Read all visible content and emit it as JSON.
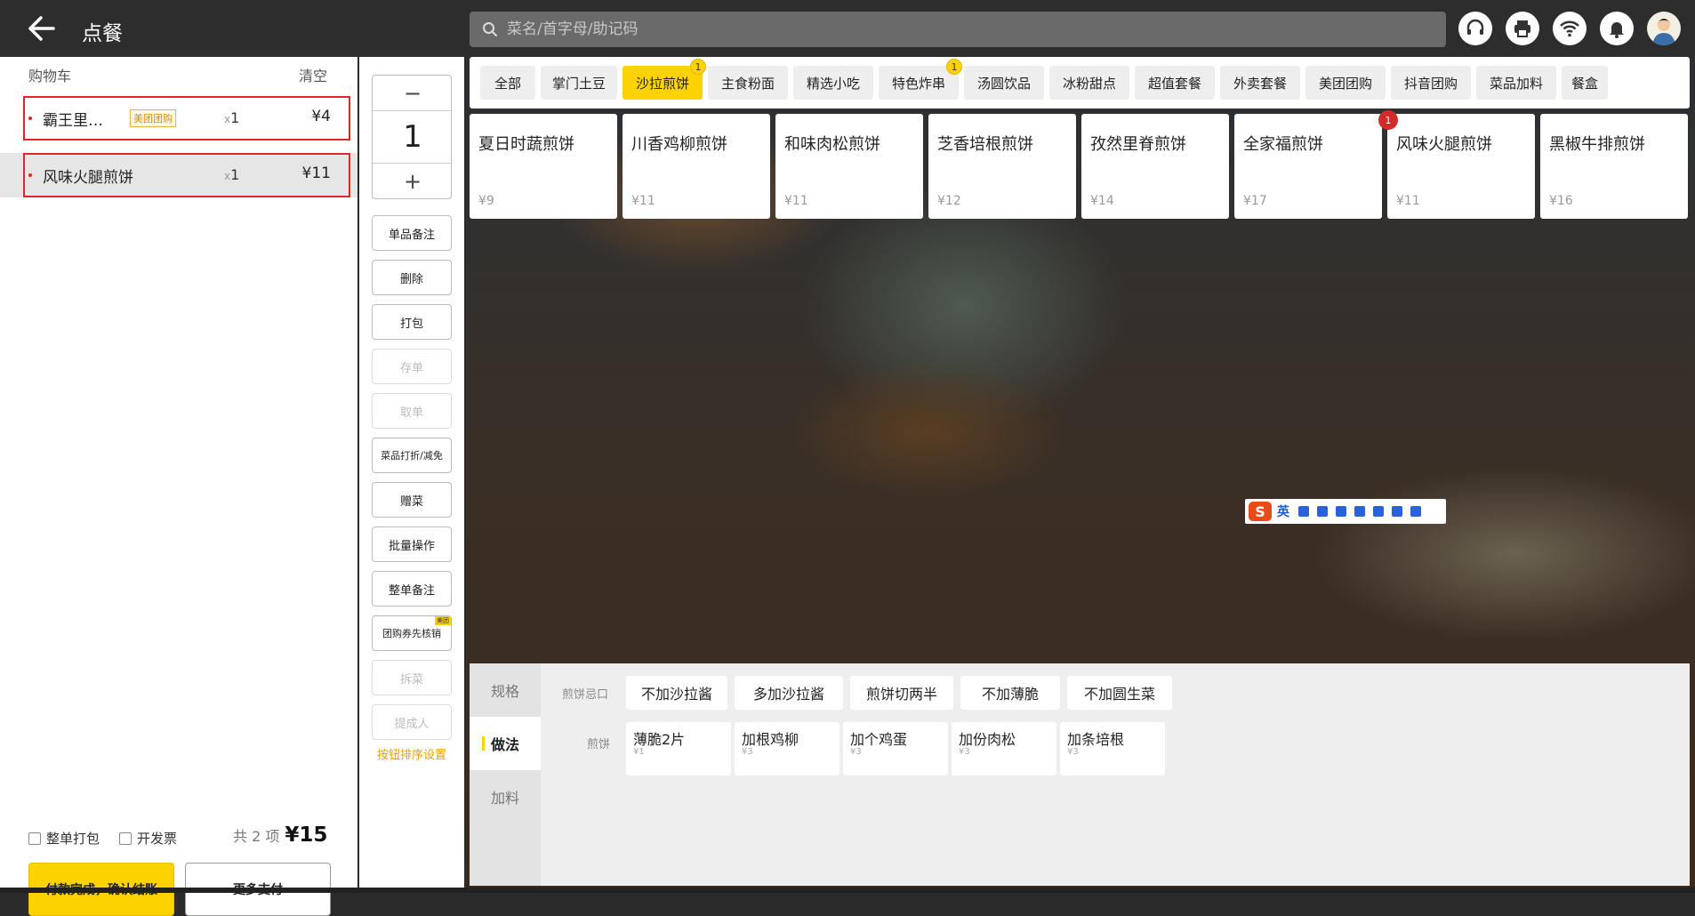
{
  "header": {
    "title": "点餐",
    "search_placeholder": "菜名/首字母/助记码",
    "icons": [
      "headset-icon",
      "printer-icon",
      "wifi-icon",
      "bell-icon",
      "avatar"
    ]
  },
  "cart": {
    "title": "购物车",
    "clear_label": "清空",
    "items": [
      {
        "name": "霸王里…",
        "tag": "美团团购",
        "qty_prefix": "x",
        "qty": "1",
        "price": "¥4"
      },
      {
        "name": "风味火腿煎饼",
        "tag": "",
        "qty_prefix": "x",
        "qty": "1",
        "price": "¥11"
      }
    ],
    "whole_pack_label": "整单打包",
    "invoice_label": "开发票",
    "total_label": "共 2 项",
    "total_value": "¥15",
    "pay_label": "付款完成，确认结账",
    "more_pay_label": "更多支付"
  },
  "actions": {
    "minus": "−",
    "quantity": "1",
    "plus": "+",
    "buttons": [
      {
        "label": "单品备注",
        "enabled": true
      },
      {
        "label": "删除",
        "enabled": true
      },
      {
        "label": "打包",
        "enabled": true
      },
      {
        "label": "存单",
        "enabled": false
      },
      {
        "label": "取单",
        "enabled": false
      },
      {
        "label": "菜品打折/减免",
        "enabled": true
      },
      {
        "label": "赠菜",
        "enabled": true
      },
      {
        "label": "批量操作",
        "enabled": true
      },
      {
        "label": "整单备注",
        "enabled": true
      },
      {
        "label": "团购券先核销",
        "enabled": true,
        "corner": "美团"
      },
      {
        "label": "拆菜",
        "enabled": false
      },
      {
        "label": "提成人",
        "enabled": false
      }
    ],
    "sort_label": "按钮排序设置"
  },
  "categories": [
    {
      "label": "全部"
    },
    {
      "label": "掌门土豆"
    },
    {
      "label": "沙拉煎饼",
      "active": true,
      "badge": "1"
    },
    {
      "label": "主食粉面"
    },
    {
      "label": "精选小吃"
    },
    {
      "label": "特色炸串",
      "badge": "1"
    },
    {
      "label": "汤圆饮品"
    },
    {
      "label": "冰粉甜点"
    },
    {
      "label": "超值套餐"
    },
    {
      "label": "外卖套餐"
    },
    {
      "label": "美团团购"
    },
    {
      "label": "抖音团购"
    },
    {
      "label": "菜品加料"
    },
    {
      "label": "餐盒"
    }
  ],
  "dishes": [
    {
      "name": "夏日时蔬煎饼",
      "price": "¥9"
    },
    {
      "name": "川香鸡柳煎饼",
      "price": "¥11"
    },
    {
      "name": "和味肉松煎饼",
      "price": "¥11"
    },
    {
      "name": "芝香培根煎饼",
      "price": "¥12"
    },
    {
      "name": "孜然里脊煎饼",
      "price": "¥14"
    },
    {
      "name": "全家福煎饼",
      "price": "¥17"
    },
    {
      "name": "风味火腿煎饼",
      "price": "¥11",
      "badge": "1"
    },
    {
      "name": "黑椒牛排煎饼",
      "price": "¥16"
    }
  ],
  "ime": {
    "logo": "S",
    "mode": "英"
  },
  "spec": {
    "tabs": [
      {
        "label": "规格"
      },
      {
        "label": "做法",
        "active": true
      },
      {
        "label": "加料"
      }
    ],
    "groups": [
      {
        "label": "煎饼忌口",
        "options": [
          {
            "name": "不加沙拉酱"
          },
          {
            "name": "多加沙拉酱"
          },
          {
            "name": "煎饼切两半"
          },
          {
            "name": "不加薄脆"
          },
          {
            "name": "不加圆生菜"
          }
        ]
      },
      {
        "label": "煎饼",
        "options": [
          {
            "name": "薄脆2片",
            "price": "¥1"
          },
          {
            "name": "加根鸡柳",
            "price": "¥3"
          },
          {
            "name": "加个鸡蛋",
            "price": "¥3"
          },
          {
            "name": "加份肉松",
            "price": "¥3"
          },
          {
            "name": "加条培根",
            "price": "¥3"
          }
        ]
      }
    ]
  },
  "colors": {
    "accent": "#fcd200",
    "danger": "#e0262c",
    "badge_red": "#d42a2a"
  }
}
